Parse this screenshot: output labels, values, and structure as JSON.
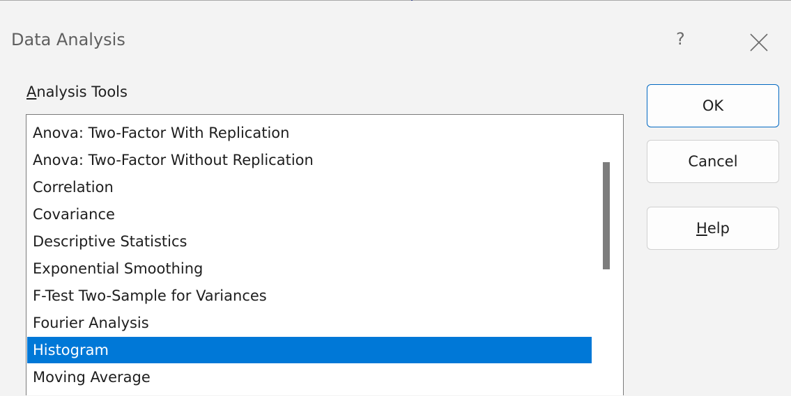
{
  "dialog": {
    "title": "Data Analysis",
    "help_symbol": "?"
  },
  "analysis_tools": {
    "label_accel": "A",
    "label_rest": "nalysis Tools",
    "items": [
      "Anova: Two-Factor With Replication",
      "Anova: Two-Factor Without Replication",
      "Correlation",
      "Covariance",
      "Descriptive Statistics",
      "Exponential Smoothing",
      "F-Test Two-Sample for Variances",
      "Fourier Analysis",
      "Histogram",
      "Moving Average"
    ],
    "selected": "Histogram"
  },
  "buttons": {
    "ok": "OK",
    "cancel": "Cancel",
    "help_accel": "H",
    "help_rest": "elp"
  },
  "colors": {
    "selection": "#0078d7",
    "primary_border": "#0067c0",
    "scrollbar_thumb": "#7d7d7d"
  },
  "icons": {
    "close": "close-icon",
    "help": "help-icon"
  }
}
